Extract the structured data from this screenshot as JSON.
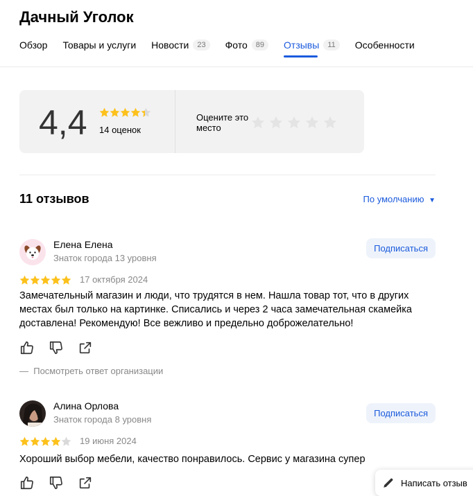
{
  "header": {
    "title": "Дачный Уголок"
  },
  "tabs": [
    {
      "label": "Обзор",
      "count": ""
    },
    {
      "label": "Товары и услуги",
      "count": ""
    },
    {
      "label": "Новости",
      "count": "23"
    },
    {
      "label": "Фото",
      "count": "89"
    },
    {
      "label": "Отзывы",
      "count": "11",
      "active": true
    },
    {
      "label": "Особенности",
      "count": ""
    }
  ],
  "rating": {
    "value": "4,4",
    "stars_fraction": 0.88,
    "count_label": "14 оценок",
    "prompt": "Оцените это место",
    "empty_stars": 5
  },
  "reviews_header": {
    "count_label": "11 отзывов",
    "sort_label": "По умолчанию"
  },
  "reviews": [
    {
      "author": "Елена Елена",
      "level": "Знаток города 13 уровня",
      "subscribe": "Подписаться",
      "stars": 5,
      "date": "17 октября 2024",
      "text": "Замечательный магазин и люди, что трудятся в нем. Нашла товар тот, что в других местах был только на картинке. Списались и через 2 часа замечательная скамейка доставлена! Рекомендую! Все вежливо и предельно доброжелательно!",
      "org_reply": "Посмотреть ответ организации"
    },
    {
      "author": "Алина Орлова",
      "level": "Знаток города 8 уровня",
      "subscribe": "Подписаться",
      "stars": 4,
      "date": "19 июня 2024",
      "text": "Хороший выбор мебели, качество понравилось. Сервис у магазина супер"
    }
  ],
  "write_review": {
    "label": "Написать отзыв"
  },
  "colors": {
    "accent": "#1a5adc",
    "star": "#fcc11c",
    "star_empty": "#d9d9d9"
  }
}
